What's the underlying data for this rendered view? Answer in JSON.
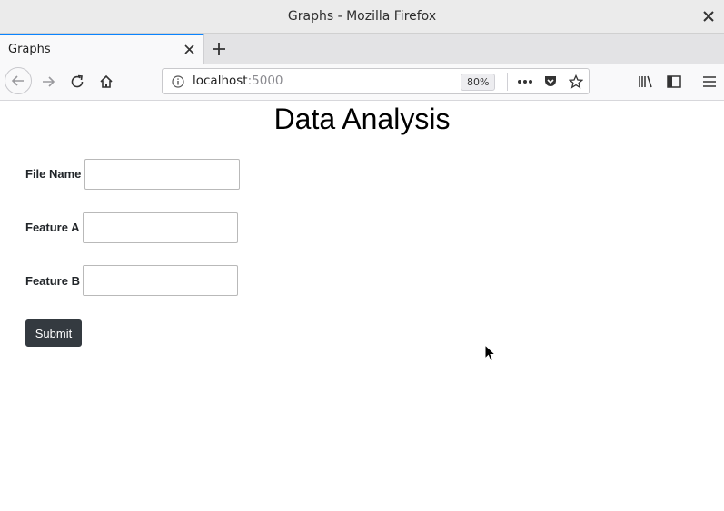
{
  "window": {
    "title": "Graphs - Mozilla Firefox"
  },
  "tabs": [
    {
      "label": "Graphs"
    }
  ],
  "urlbar": {
    "host": "localhost",
    "port": ":5000",
    "zoom": "80%"
  },
  "page": {
    "title": "Data Analysis",
    "fields": [
      {
        "label": "File Name",
        "value": ""
      },
      {
        "label": "Feature A",
        "value": ""
      },
      {
        "label": "Feature B",
        "value": ""
      }
    ],
    "submit_label": "Submit"
  }
}
